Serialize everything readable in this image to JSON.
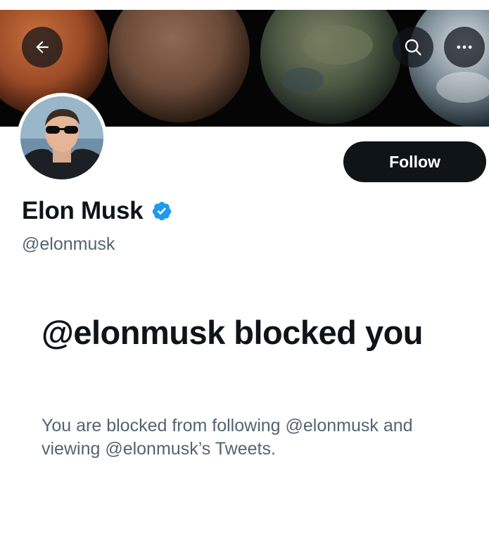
{
  "header": {
    "back_icon": "arrow-left-icon",
    "search_icon": "search-icon",
    "more_icon": "more-horizontal-icon"
  },
  "profile": {
    "display_name": "Elon Musk",
    "handle": "@elonmusk",
    "verified_icon": "verified-badge-icon",
    "follow_label": "Follow"
  },
  "blocked": {
    "title": "@elonmusk blocked you",
    "description": "You are blocked from following @elonmusk and viewing @elonmusk’s Tweets."
  },
  "colors": {
    "primary_text": "#0f1419",
    "secondary_text": "#536471",
    "verified_blue": "#1d9bf0",
    "button_bg": "#0f1419"
  }
}
